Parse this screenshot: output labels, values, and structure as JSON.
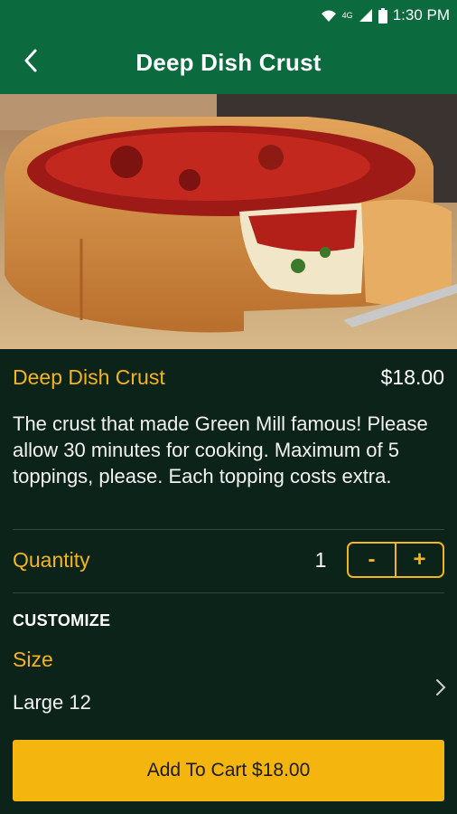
{
  "status_bar": {
    "time": "1:30 PM",
    "network": "4G",
    "icons": [
      "wifi-icon",
      "signal-icon",
      "battery-icon"
    ]
  },
  "app_bar": {
    "title": "Deep Dish Crust",
    "back_icon": "chevron-left-icon"
  },
  "item": {
    "name": "Deep Dish Crust",
    "price": "$18.00",
    "description": "The crust that made Green Mill famous! Please allow 30 minutes for cooking. Maximum of 5 toppings, please. Each topping costs extra."
  },
  "quantity": {
    "label": "Quantity",
    "value": "1",
    "decrement_label": "-",
    "increment_label": "+"
  },
  "customize": {
    "heading": "CUSTOMIZE",
    "size_label": "Size",
    "size_value": "Large 12"
  },
  "cart_button": {
    "label": "Add To Cart $18.00"
  },
  "colors": {
    "header": "#0b6b3e",
    "background": "#0c2319",
    "accent": "#f4b41c"
  }
}
